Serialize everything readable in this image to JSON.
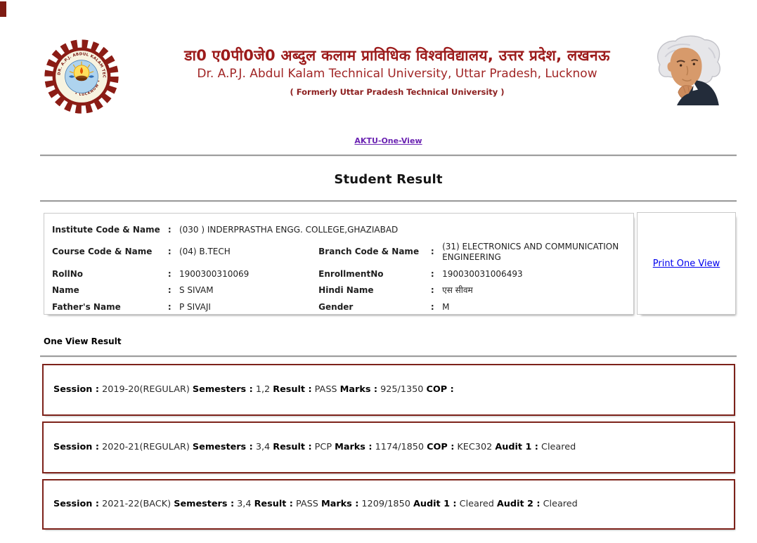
{
  "header": {
    "title_hindi": "डा0 ए0पी0जे0 अब्दुल कलाम प्राविधिक विश्वविद्यालय, उत्तर प्रदेश, लखनऊ",
    "title_english": "Dr. A.P.J. Abdul Kalam Technical University, Uttar Pradesh, Lucknow",
    "formerly": "( Formerly Uttar Pradesh Technical University )",
    "logo_icon": "aktu-university-gear-emblem",
    "portrait_icon": "dr-apj-abdul-kalam-portrait"
  },
  "nav": {
    "one_view_link": "AKTU-One-View"
  },
  "page": {
    "section_title": "Student Result",
    "one_view_result_label": "One View Result"
  },
  "colors": {
    "maroon_title": "#9c1b1b",
    "result_box_border": "#7d221a",
    "info_box_border": "#c9c9c9",
    "link_purple": "#6b24b2",
    "link_blue": "#0000ee"
  },
  "student_info": {
    "print_link": "Print One View",
    "colon": ":",
    "rows": [
      {
        "cells": [
          {
            "label": "Institute Code & Name",
            "value": "(030 ) INDERPRASTHA ENGG. COLLEGE,GHAZIABAD",
            "span": true
          }
        ]
      },
      {
        "cells": [
          {
            "label": "Course Code & Name",
            "value": "(04) B.TECH"
          },
          {
            "label": "Branch Code & Name",
            "value": "(31) ELECTRONICS AND COMMUNICATION ENGINEERING"
          }
        ]
      },
      {
        "cells": [
          {
            "label": "RollNo",
            "value": "1900300310069"
          },
          {
            "label": "EnrollmentNo",
            "value": "190030031006493"
          }
        ]
      },
      {
        "cells": [
          {
            "label": "Name",
            "value": "S SIVAM"
          },
          {
            "label": "Hindi Name",
            "value": "एस सीवम"
          }
        ]
      },
      {
        "cells": [
          {
            "label": "Father's Name",
            "value": "P SIVAJI"
          },
          {
            "label": "Gender",
            "value": "M"
          }
        ]
      }
    ]
  },
  "results": [
    {
      "segments": [
        {
          "label": "Session :",
          "value": "2019-20(REGULAR)"
        },
        {
          "label": "Semesters :",
          "value": "1,2"
        },
        {
          "label": "Result :",
          "value": "PASS"
        },
        {
          "label": "Marks :",
          "value": "925/1350"
        },
        {
          "label": "COP :",
          "value": ""
        }
      ]
    },
    {
      "segments": [
        {
          "label": "Session :",
          "value": "2020-21(REGULAR)"
        },
        {
          "label": "Semesters :",
          "value": "3,4"
        },
        {
          "label": "Result :",
          "value": "PCP"
        },
        {
          "label": "Marks :",
          "value": "1174/1850"
        },
        {
          "label": "COP :",
          "value": "KEC302"
        },
        {
          "label": "Audit 1 :",
          "value": "Cleared"
        }
      ]
    },
    {
      "segments": [
        {
          "label": "Session :",
          "value": "2021-22(BACK)"
        },
        {
          "label": "Semesters :",
          "value": "3,4"
        },
        {
          "label": "Result :",
          "value": "PASS"
        },
        {
          "label": "Marks :",
          "value": "1209/1850"
        },
        {
          "label": "Audit 1 :",
          "value": "Cleared"
        },
        {
          "label": "Audit 2 :",
          "value": "Cleared"
        }
      ]
    }
  ]
}
